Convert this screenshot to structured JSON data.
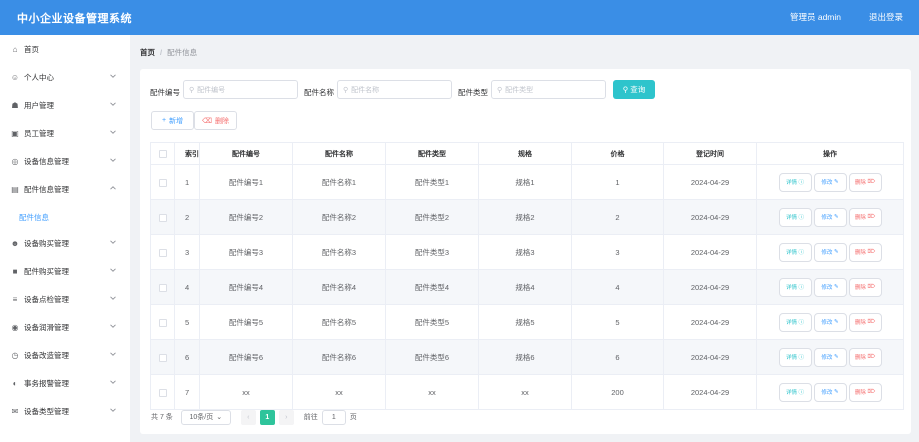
{
  "app": {
    "title": "中小企业设备管理系统",
    "user": "管理员 admin",
    "logout": "退出登录"
  },
  "sidebar": {
    "items": [
      {
        "label": "首页",
        "icon": "home-icon",
        "chevron": false
      },
      {
        "label": "个人中心",
        "icon": "user-icon",
        "chevron": true
      },
      {
        "label": "用户管理",
        "icon": "users-icon",
        "chevron": true
      },
      {
        "label": "员工管理",
        "icon": "staff-icon",
        "chevron": true
      },
      {
        "label": "设备信息管理",
        "icon": "device-icon",
        "chevron": true
      },
      {
        "label": "配件信息管理",
        "icon": "parts-icon",
        "chevron": true,
        "expanded": true
      },
      {
        "label": "设备购买管理",
        "icon": "purchase-icon",
        "chevron": true
      },
      {
        "label": "配件购买管理",
        "icon": "cart-icon",
        "chevron": true
      },
      {
        "label": "设备点检管理",
        "icon": "list-icon",
        "chevron": true
      },
      {
        "label": "设备润滑管理",
        "icon": "oil-icon",
        "chevron": true
      },
      {
        "label": "设备改造管理",
        "icon": "clock-icon",
        "chevron": true
      },
      {
        "label": "事务报警管理",
        "icon": "alarm-icon",
        "chevron": true
      },
      {
        "label": "设备类型管理",
        "icon": "mail-icon",
        "chevron": true
      }
    ],
    "sub_active": "配件信息"
  },
  "breadcrumb": {
    "home": "首页",
    "sep": "/",
    "current": "配件信息"
  },
  "filters": [
    {
      "label": "配件编号",
      "placeholder": "配件编号"
    },
    {
      "label": "配件名称",
      "placeholder": "配件名称"
    },
    {
      "label": "配件类型",
      "placeholder": "配件类型"
    }
  ],
  "buttons": {
    "query": "查询",
    "add": "新增",
    "delete": "删除"
  },
  "table": {
    "headers": [
      "",
      "索引",
      "配件编号",
      "配件名称",
      "配件类型",
      "规格",
      "价格",
      "登记时间",
      "操作"
    ],
    "rows": [
      {
        "index": "1",
        "code": "配件编号1",
        "name": "配件名称1",
        "type": "配件类型1",
        "spec": "规格1",
        "price": "1",
        "date": "2024-04-29"
      },
      {
        "index": "2",
        "code": "配件编号2",
        "name": "配件名称2",
        "type": "配件类型2",
        "spec": "规格2",
        "price": "2",
        "date": "2024-04-29"
      },
      {
        "index": "3",
        "code": "配件编号3",
        "name": "配件名称3",
        "type": "配件类型3",
        "spec": "规格3",
        "price": "3",
        "date": "2024-04-29"
      },
      {
        "index": "4",
        "code": "配件编号4",
        "name": "配件名称4",
        "type": "配件类型4",
        "spec": "规格4",
        "price": "4",
        "date": "2024-04-29"
      },
      {
        "index": "5",
        "code": "配件编号5",
        "name": "配件名称5",
        "type": "配件类型5",
        "spec": "规格5",
        "price": "5",
        "date": "2024-04-29"
      },
      {
        "index": "6",
        "code": "配件编号6",
        "name": "配件名称6",
        "type": "配件类型6",
        "spec": "规格6",
        "price": "6",
        "date": "2024-04-29"
      },
      {
        "index": "7",
        "code": "xx",
        "name": "xx",
        "type": "xx",
        "spec": "xx",
        "price": "200",
        "date": "2024-04-29"
      }
    ],
    "actions": {
      "view": "详情",
      "edit": "修改",
      "delete": "删除"
    }
  },
  "pagination": {
    "total": "共 7 条",
    "page_size": "10条/页",
    "current": "1",
    "goto": "前往",
    "goto_value": "1",
    "page_suffix": "页"
  }
}
